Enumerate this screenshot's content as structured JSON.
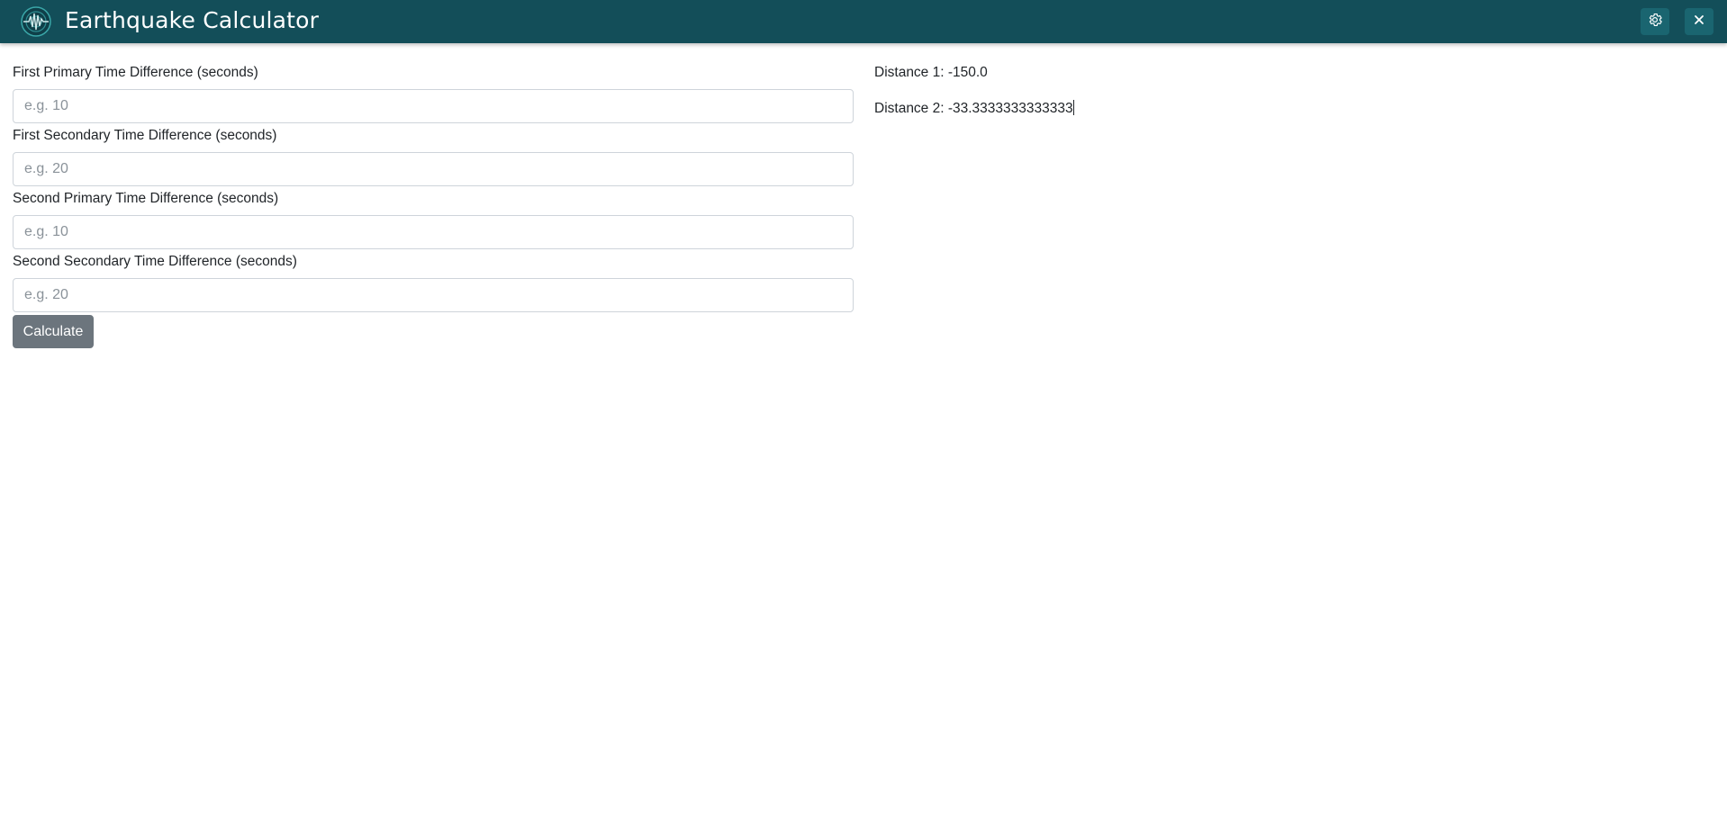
{
  "app": {
    "title": "Earthquake Calculator",
    "logo_icon": "seismograph-globe-icon",
    "settings_icon": "gear-icon",
    "close_icon": "close-icon",
    "header_color": "#134e59"
  },
  "form": {
    "fields": [
      {
        "label": "First Primary Time Difference (seconds)",
        "placeholder": "e.g. 10",
        "value": ""
      },
      {
        "label": "First Secondary Time Difference (seconds)",
        "placeholder": "e.g. 20",
        "value": ""
      },
      {
        "label": "Second Primary Time Difference (seconds)",
        "placeholder": "e.g. 10",
        "value": ""
      },
      {
        "label": "Second Secondary Time Difference (seconds)",
        "placeholder": "e.g. 20",
        "value": ""
      }
    ],
    "calculate_label": "Calculate"
  },
  "results": {
    "distance1": "Distance 1: -150.0",
    "distance2": "Distance 2: -33.3333333333333"
  }
}
